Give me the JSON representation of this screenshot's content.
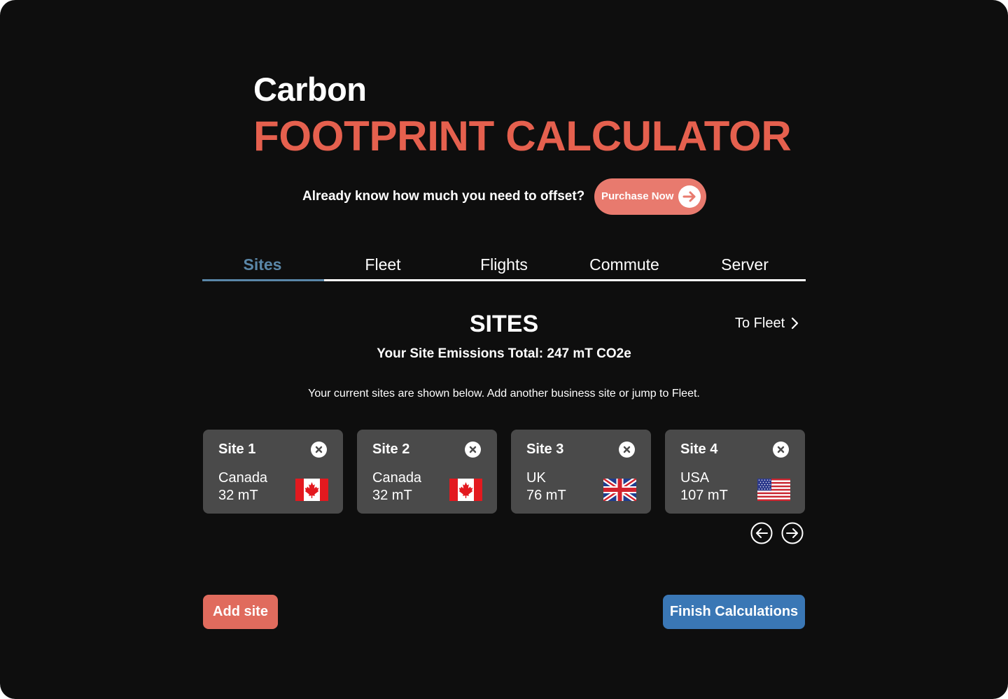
{
  "header": {
    "title_line1": "Carbon",
    "title_line2": "FOOTPRINT CALCULATOR"
  },
  "offset": {
    "question": "Already know how much you need to offset?",
    "purchase_label": "Purchase Now",
    "purchase_icon": "arrow-right-icon"
  },
  "tabs": [
    {
      "label": "Sites",
      "active": true
    },
    {
      "label": "Fleet",
      "active": false
    },
    {
      "label": "Flights",
      "active": false
    },
    {
      "label": "Commute",
      "active": false
    },
    {
      "label": "Server",
      "active": false
    }
  ],
  "section": {
    "title": "SITES",
    "next_link": "To Fleet",
    "total": "Your Site Emissions Total: 247 mT CO2e",
    "help_text": "Your current sites are shown below. Add another business site or jump to Fleet."
  },
  "sites": [
    {
      "name": "Site 1",
      "country": "Canada",
      "amount": "32 mT",
      "flag": "canada-flag-icon"
    },
    {
      "name": "Site 2",
      "country": "Canada",
      "amount": "32 mT",
      "flag": "canada-flag-icon"
    },
    {
      "name": "Site 3",
      "country": "UK",
      "amount": "76 mT",
      "flag": "uk-flag-icon"
    },
    {
      "name": "Site 4",
      "country": "USA",
      "amount": "107 mT",
      "flag": "usa-flag-icon"
    }
  ],
  "actions": {
    "add_site": "Add site",
    "finish": "Finish Calculations"
  },
  "colors": {
    "background": "#0e0e0e",
    "accent_coral": "#e5604e",
    "purchase_button": "#e87a6e",
    "add_button": "#e06b5d",
    "finish_button": "#3a77b5",
    "tab_active": "#5a87a8",
    "card": "#4a4a4a"
  }
}
